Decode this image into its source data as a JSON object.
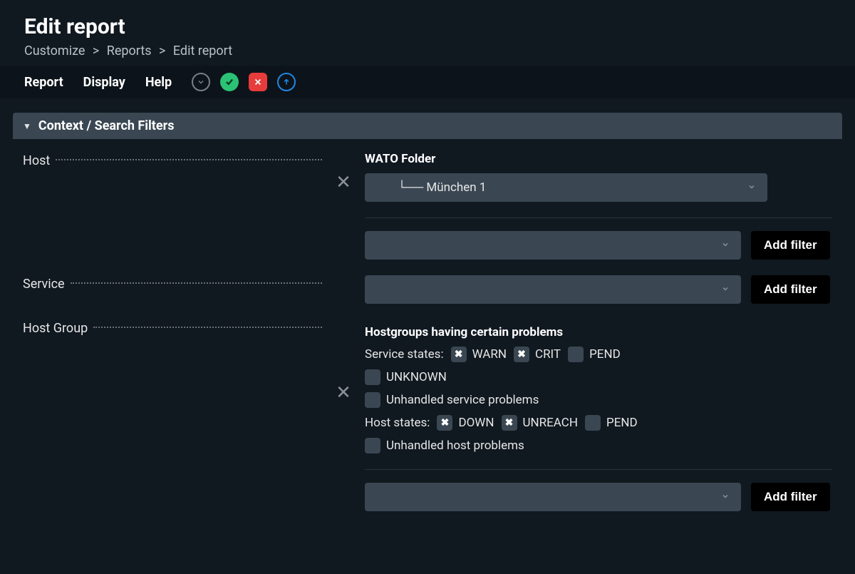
{
  "header": {
    "title": "Edit report",
    "breadcrumb": [
      "Customize",
      "Reports",
      "Edit report"
    ]
  },
  "menu": {
    "items": [
      "Report",
      "Display",
      "Help"
    ]
  },
  "section": {
    "title": "Context / Search Filters"
  },
  "filters": {
    "host": {
      "label": "Host",
      "wato_label": "WATO Folder",
      "wato_value": "└── München 1",
      "add_filter": "Add filter"
    },
    "service": {
      "label": "Service",
      "add_filter": "Add filter"
    },
    "hostgroup": {
      "label": "Host Group",
      "title": "Hostgroups having certain problems",
      "service_states_label": "Service states:",
      "host_states_label": "Host states:",
      "options": {
        "warn": "WARN",
        "crit": "CRIT",
        "pend_svc": "PEND",
        "unknown": "UNKNOWN",
        "unhandled_svc": "Unhandled service problems",
        "down": "DOWN",
        "unreach": "UNREACH",
        "pend_host": "PEND",
        "unhandled_host": "Unhandled host problems"
      },
      "checked": {
        "warn": true,
        "crit": true,
        "pend_svc": false,
        "unknown": false,
        "unhandled_svc": false,
        "down": true,
        "unreach": true,
        "pend_host": false,
        "unhandled_host": false
      },
      "add_filter": "Add filter"
    }
  }
}
